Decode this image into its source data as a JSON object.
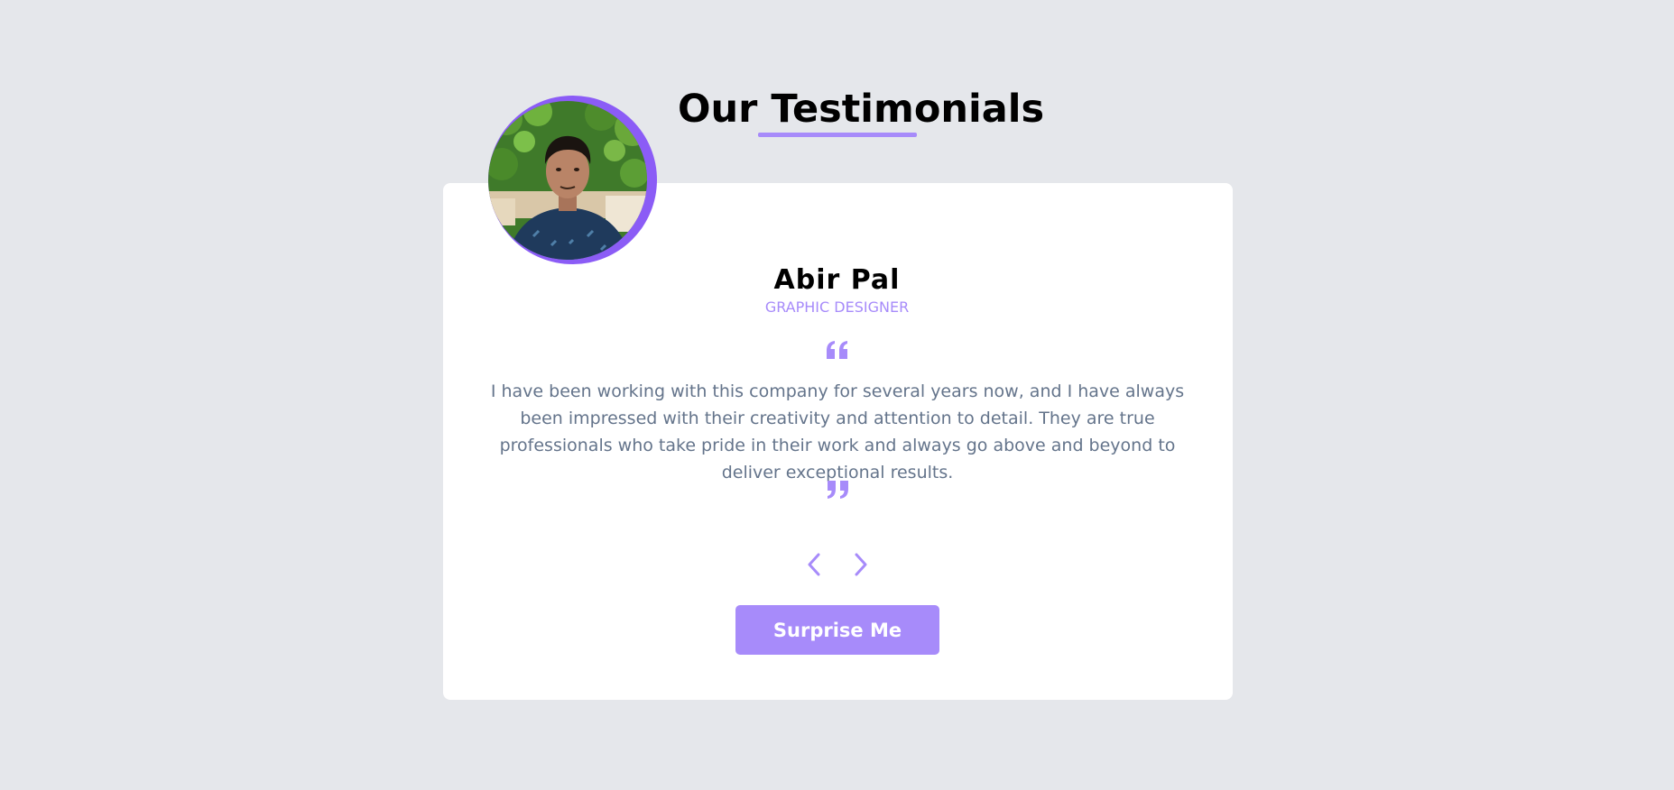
{
  "header": {
    "title": "Our Testimonials"
  },
  "testimonial": {
    "avatar_icon": "person-photo",
    "name": "Abir Pal",
    "role": "GRAPHIC DESIGNER",
    "quote_open_icon": "quote-left-icon",
    "text": "I have been working with this company for several years now, and I have always been impressed with their creativity and attention to detail. They are true professionals who take pride in their work and always go above and beyond to deliver exceptional results.",
    "quote_close_icon": "quote-right-icon"
  },
  "controls": {
    "prev_icon": "chevron-left-icon",
    "next_icon": "chevron-right-icon",
    "surprise_label": "Surprise Me"
  },
  "colors": {
    "accent": "#a78bfa",
    "accent_dark": "#8b5cf6",
    "background": "#e5e7eb",
    "card": "#ffffff",
    "body_text": "#64748b"
  }
}
